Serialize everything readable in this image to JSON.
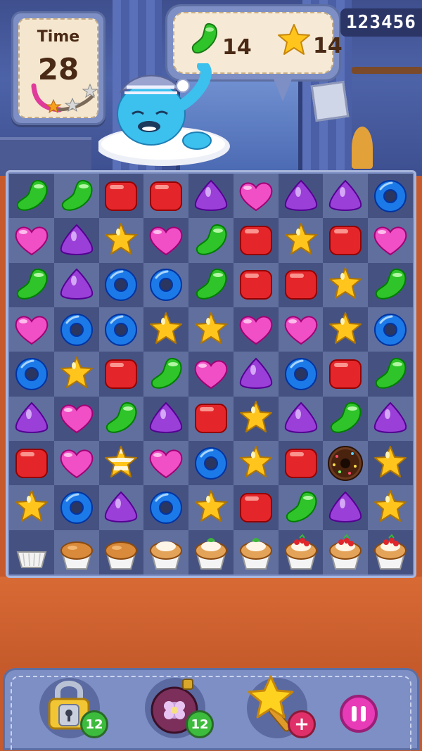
{
  "hud": {
    "time_label": "Time",
    "time_value": "28",
    "score": "123456",
    "stars_earned": 1,
    "stars_total": 3
  },
  "goals": [
    {
      "item": "green-jelly",
      "count": "14"
    },
    {
      "item": "yellow-star",
      "count": "14"
    }
  ],
  "board": {
    "rows": [
      [
        "green-jelly",
        "green-jelly",
        "red-square",
        "red-square",
        "purple-drop",
        "pink-heart",
        "purple-drop",
        "purple-drop",
        "blue-ring"
      ],
      [
        "pink-heart",
        "purple-drop",
        "yellow-star",
        "pink-heart",
        "green-jelly",
        "red-square",
        "yellow-star",
        "red-square",
        "pink-heart"
      ],
      [
        "green-jelly",
        "purple-drop",
        "blue-ring",
        "blue-ring",
        "green-jelly",
        "red-square",
        "red-square",
        "yellow-star",
        "green-jelly"
      ],
      [
        "pink-heart",
        "blue-ring",
        "blue-ring",
        "yellow-star",
        "yellow-star",
        "pink-heart",
        "pink-heart",
        "yellow-star",
        "blue-ring"
      ],
      [
        "blue-ring",
        "yellow-star",
        "red-square",
        "green-jelly",
        "pink-heart",
        "purple-drop",
        "blue-ring",
        "red-square",
        "green-jelly"
      ],
      [
        "purple-drop",
        "pink-heart",
        "green-jelly",
        "purple-drop",
        "red-square",
        "yellow-star",
        "purple-drop",
        "green-jelly",
        "purple-drop"
      ],
      [
        "red-square",
        "pink-heart",
        "striped-star",
        "pink-heart",
        "blue-ring",
        "yellow-star",
        "red-square",
        "chocolate-donut",
        "yellow-star"
      ],
      [
        "yellow-star",
        "blue-ring",
        "purple-drop",
        "blue-ring",
        "yellow-star",
        "red-square",
        "green-jelly",
        "purple-drop",
        "yellow-star"
      ],
      [
        "empty-cup",
        "plain-cupcake",
        "plain-cupcake",
        "cream-cupcake",
        "leaf-cupcake",
        "leaf-cupcake",
        "berry-cupcake",
        "berry-cupcake",
        "berry-cupcake"
      ]
    ]
  },
  "boosters": [
    {
      "name": "lock",
      "count": "12"
    },
    {
      "name": "bomb",
      "count": "12"
    },
    {
      "name": "star-wand",
      "count": "+"
    }
  ],
  "colors": {
    "green": "#2fc42a",
    "red": "#e4262a",
    "purple": "#9a3fd8",
    "pink": "#f04fc5",
    "blue": "#1c7ae8",
    "yellow": "#ffc51c"
  }
}
